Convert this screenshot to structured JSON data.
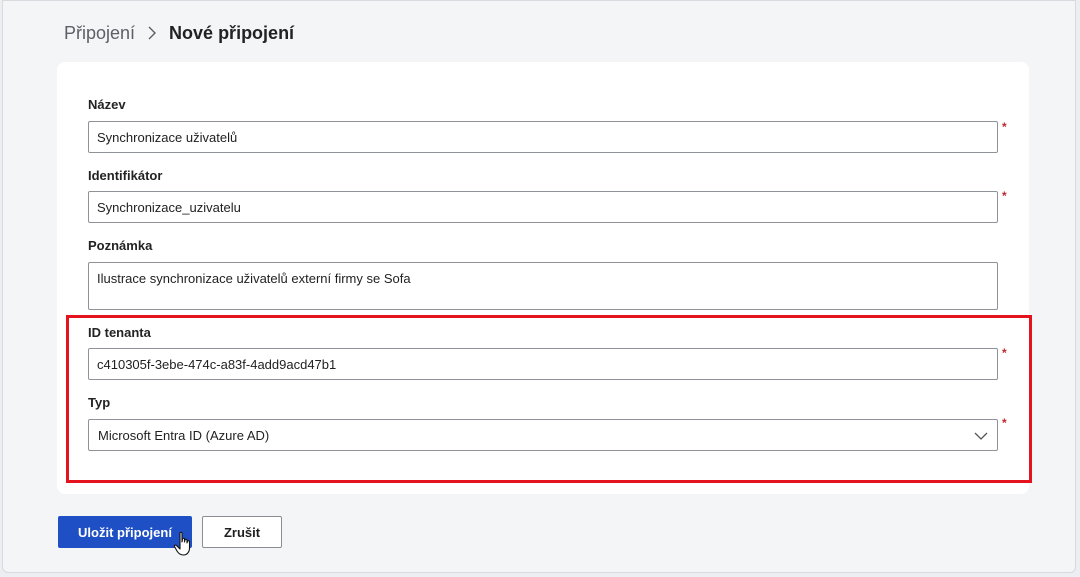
{
  "breadcrumb": {
    "parent": "Připojení",
    "current": "Nové připojení"
  },
  "form": {
    "name": {
      "label": "Název",
      "value": "Synchronizace uživatelů",
      "required": "*"
    },
    "identifier": {
      "label": "Identifikátor",
      "value": "Synchronizace_uzivatelu",
      "required": "*"
    },
    "note": {
      "label": "Poznámka",
      "value": "Ilustrace synchronizace uživatelů externí firmy se Sofa"
    },
    "tenant": {
      "label": "ID tenanta",
      "value": "c410305f-3ebe-474c-a83f-4add9acd47b1",
      "required": "*"
    },
    "type": {
      "label": "Typ",
      "value": "Microsoft Entra ID (Azure AD)",
      "required": "*"
    }
  },
  "actions": {
    "save_label": "Uložit připojení",
    "cancel_label": "Zrušit"
  },
  "colors": {
    "primary": "#1f4fc4",
    "highlight": "#e5131d",
    "required": "#c4262e"
  },
  "icons": {
    "breadcrumb_separator": "chevron-right-icon",
    "select_arrow": "chevron-down-icon",
    "cursor": "hand-pointer-icon"
  }
}
